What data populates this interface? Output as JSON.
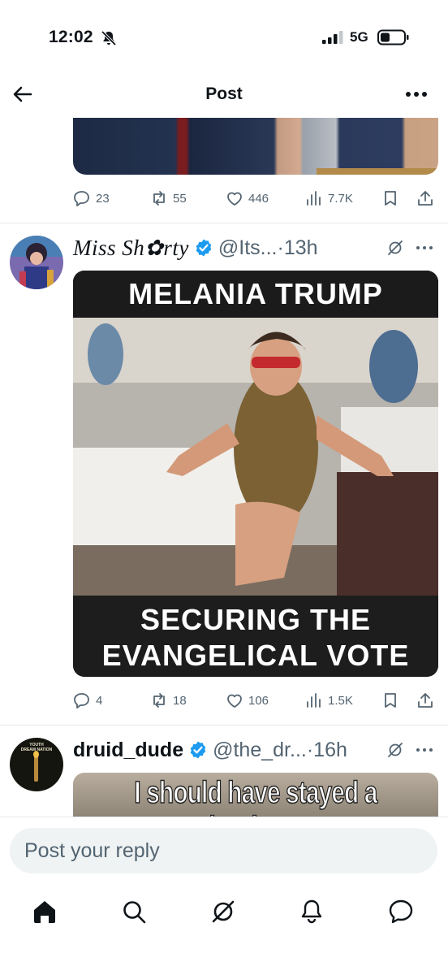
{
  "status_bar": {
    "time": "12:02",
    "network": "5G",
    "icons": [
      "bell-slash-icon",
      "signal-icon",
      "battery-icon"
    ]
  },
  "header": {
    "title": "Post",
    "back_icon": "arrow-left-icon",
    "more_icon": "more-horizontal-icon"
  },
  "tweets": [
    {
      "actions": {
        "replies": "23",
        "reposts": "55",
        "likes": "446",
        "views": "7.7K"
      }
    },
    {
      "display_name": "Miss Sh✿rty",
      "handle": "@Its...",
      "separator": "·",
      "time": "13h",
      "verified": true,
      "media": {
        "top_caption": "MELANIA TRUMP",
        "bottom_caption_line1": "SECURING THE",
        "bottom_caption_line2": "EVANGELICAL VOTE"
      },
      "actions": {
        "replies": "4",
        "reposts": "18",
        "likes": "106",
        "views": "1.5K"
      }
    },
    {
      "display_name": "druid_dude",
      "handle": "@the_dr...",
      "separator": "·",
      "time": "16h",
      "verified": true,
      "avatar_text_line1": "YOUTH",
      "avatar_text_line2": "DREAM NATION",
      "media": {
        "caption": "I should have stayed a hooker..."
      }
    }
  ],
  "reply": {
    "placeholder": "Post your reply"
  },
  "tabbar": {
    "tabs": [
      "home-icon",
      "search-icon",
      "grok-icon",
      "notifications-icon",
      "messages-icon"
    ]
  },
  "colors": {
    "accent": "#1d9bf0",
    "muted": "#536471",
    "text": "#0f1419"
  }
}
